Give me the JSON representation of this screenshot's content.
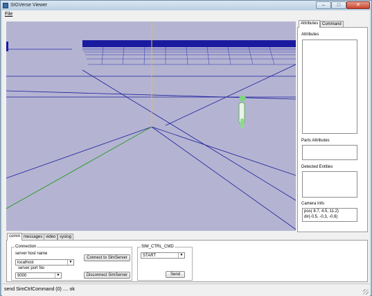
{
  "window": {
    "title": "SIGVerse Viewer"
  },
  "menu": {
    "file": "File"
  },
  "right_panel": {
    "tabs": [
      "Attributes",
      "Command"
    ],
    "attributes_label": "Attributes",
    "parts_attributes_label": "Parts Attributes",
    "detected_entities_label": "Detected Entities",
    "camera_info_label": "Camera Info",
    "camera_pos": "pos( 8.7,  4.5, 11.2)",
    "camera_dir": "dir(-0.5, -0.3, -0.8)"
  },
  "bottom_tabs": [
    "comm",
    "messages",
    "video",
    "syslog"
  ],
  "connection": {
    "group_label": "Connection",
    "host_label": "server host name",
    "host_value": "localhost",
    "port_label": "server port No",
    "port_value": "9000",
    "connect_button": "Connect to SimServer",
    "disconnect_button": "Disconnect SimServer"
  },
  "sim_ctrl": {
    "group_label": "SIM_CTRL_CMD",
    "selected": "START",
    "send_button": "Send"
  },
  "status": {
    "text": "send SimCtrlCommand (0) .... ok"
  },
  "colors": {
    "viewport_bg": "#b4b4d2",
    "grid": "#1c1c9c",
    "axis_y": "#e2c23c",
    "axis_x": "#2f9a2f"
  }
}
